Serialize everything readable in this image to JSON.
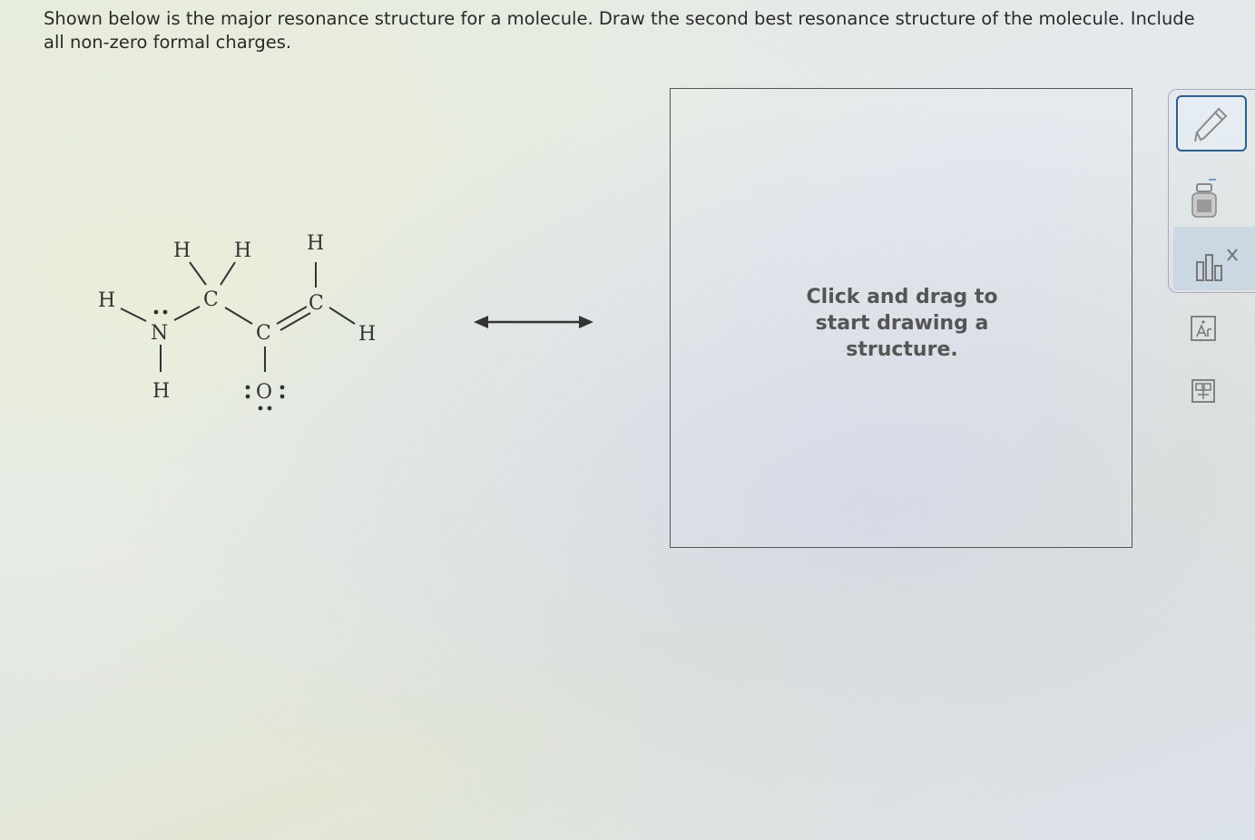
{
  "question": {
    "text": "Shown below is the major resonance structure for a molecule. Draw the second best resonance structure of the molecule. Include all non-zero formal charges."
  },
  "molecule": {
    "atoms": {
      "h_n_left": "H",
      "n": "N",
      "h_n_bottom": "H",
      "h_c1_left": "H",
      "h_c1_right": "H",
      "c1": "C",
      "c2": "C",
      "o": "O",
      "c3": "C",
      "h_c3_top": "H",
      "h_c3_right": "H"
    }
  },
  "drawing_area": {
    "hint": "Click and drag to start drawing a structure."
  },
  "toolbar": {
    "tools": [
      {
        "icon": "pencil-icon"
      },
      {
        "icon": "eraser-icon"
      },
      {
        "icon": "formal-charge-icon"
      },
      {
        "icon": "atom-label-icon"
      },
      {
        "icon": "templates-icon"
      }
    ],
    "active_color": "#2f5f8a"
  }
}
